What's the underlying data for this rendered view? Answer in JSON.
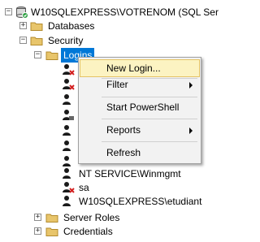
{
  "tree": {
    "server_label": "W10SQLEXPRESS\\VOTRENOM (SQL Ser",
    "databases_label": "Databases",
    "security_label": "Security",
    "logins_label": "Logins",
    "login_items": [
      {
        "label": "",
        "icon": "login-disabled-icon"
      },
      {
        "label": "",
        "icon": "login-disabled-icon"
      },
      {
        "label": "",
        "icon": "login-icon"
      },
      {
        "label": "",
        "icon": "certificate-login-icon"
      },
      {
        "label": "",
        "icon": "login-icon"
      },
      {
        "label": "",
        "icon": "login-icon"
      },
      {
        "label": "",
        "icon": "login-icon"
      },
      {
        "label": "NT SERVICE\\Winmgmt",
        "icon": "login-icon"
      },
      {
        "label": "sa",
        "icon": "login-disabled-icon"
      },
      {
        "label": "W10SQLEXPRESS\\etudiant",
        "icon": "login-icon"
      }
    ],
    "server_roles_label": "Server Roles",
    "credentials_label": "Credentials"
  },
  "context_menu": {
    "items": [
      {
        "label": "New Login...",
        "has_submenu": false,
        "highlighted": true
      },
      {
        "label": "Filter",
        "has_submenu": true,
        "highlighted": false
      },
      {
        "label": "Start PowerShell",
        "has_submenu": false,
        "highlighted": false
      },
      {
        "label": "Reports",
        "has_submenu": true,
        "highlighted": false
      },
      {
        "label": "Refresh",
        "has_submenu": false,
        "highlighted": false
      }
    ]
  },
  "colors": {
    "selection": "#0078d7",
    "menu_highlight": "#fcf3c2",
    "folder": "#dcb35c"
  }
}
